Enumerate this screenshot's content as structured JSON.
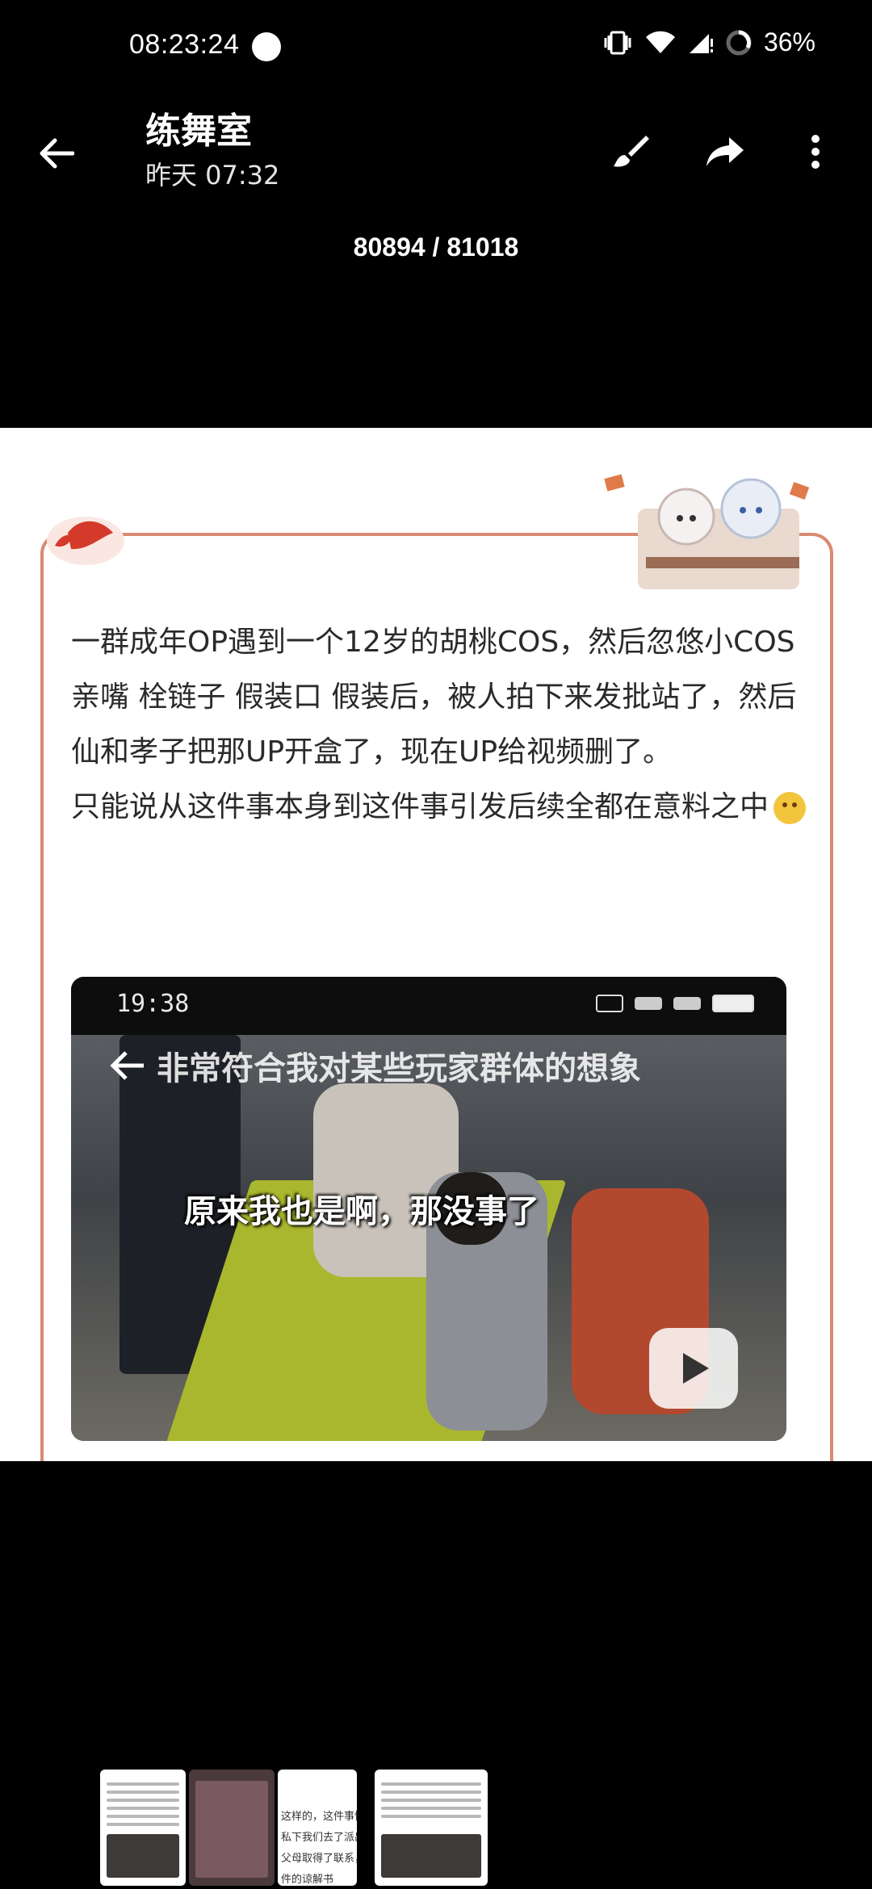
{
  "status_bar": {
    "time": "08:23:24",
    "battery": "36%"
  },
  "header": {
    "title": "练舞室",
    "subtitle": "昨天 07:32",
    "counter": "80894 / 81018",
    "icons": [
      "back-arrow-icon",
      "brush-icon",
      "share-icon",
      "more-vert-icon"
    ]
  },
  "post": {
    "paragraph1": "一群成年OP遇到一个12岁的胡桃COS，然后忽悠小COS亲嘴 栓链子 假装口 假装后，被人拍下来发批站了，然后仙和孝子把那UP开盒了，现在UP给视频删了。",
    "paragraph2": "只能说从这件事本身到这件事引发后续全都在意料之中",
    "embedded_screenshot": {
      "time": "19:38",
      "nav_title": "非常符合我对某些玩家群体的想象",
      "caption": "原来我也是啊，那没事了"
    }
  },
  "thumbnails": {
    "thumb3_lines": [
      "这样的，这件事情在",
      "私下我们去了派出所",
      "父母取得了联系，已",
      "件的谅解书"
    ]
  },
  "colors": {
    "frame": "#d98a72",
    "background": "#000000"
  }
}
